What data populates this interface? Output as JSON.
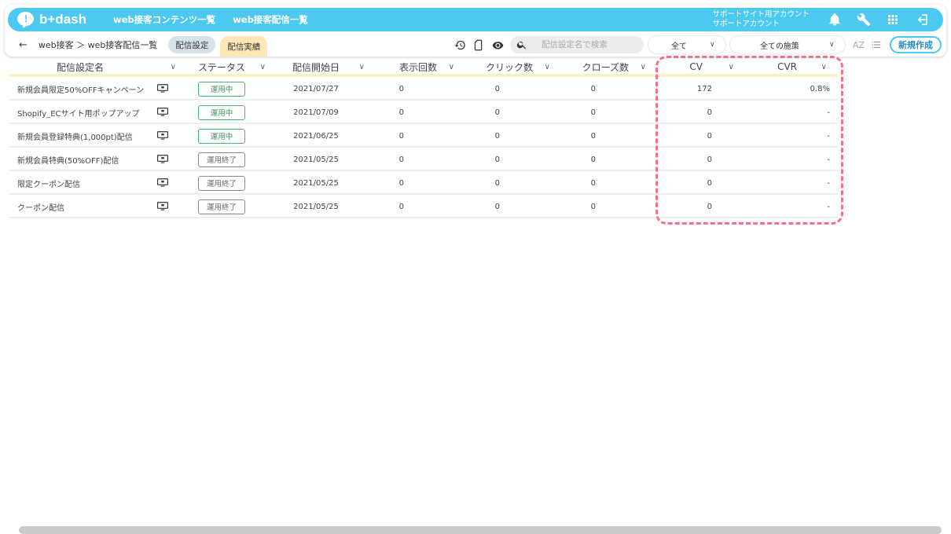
{
  "app": {
    "logo_text": "b+dash",
    "nav": [
      "web接客コンテンツ一覧",
      "web接客配信一覧"
    ],
    "account_line1": "サポートサイト用アカウント",
    "account_line2": "サポートアカウント",
    "accent_color": "#4cc9f0"
  },
  "subbar": {
    "back": "←",
    "breadcrumb": "web接客 ＞ web接客配信一覧",
    "tab_settings": "配信設定",
    "tab_results": "配信実績",
    "search_placeholder": "配信設定名で検索",
    "filter1": "全て",
    "filter2": "全ての施策",
    "sort_label": "AZ",
    "new_button": "新規作成"
  },
  "table": {
    "headers": {
      "name": "配信設定名",
      "status": "ステータス",
      "start": "配信開始日",
      "impressions": "表示回数",
      "clicks": "クリック数",
      "closes": "クローズ数",
      "cv": "CV",
      "cvr": "CVR"
    },
    "rows": [
      {
        "name": "新規会員限定50%OFFキャンペーン",
        "status": "運用中",
        "status_type": "active",
        "start": "2021/07/27",
        "impressions": "0",
        "clicks": "0",
        "closes": "0",
        "cv": "172",
        "cvr": "0.8%"
      },
      {
        "name": "Shopify_ECサイト用ポップアップ",
        "status": "運用中",
        "status_type": "active",
        "start": "2021/07/09",
        "impressions": "0",
        "clicks": "0",
        "closes": "0",
        "cv": "0",
        "cvr": "-"
      },
      {
        "name": "新規会員登録特典(1,000pt)配信",
        "status": "運用中",
        "status_type": "active",
        "start": "2021/06/25",
        "impressions": "0",
        "clicks": "0",
        "closes": "0",
        "cv": "0",
        "cvr": "-"
      },
      {
        "name": "新規会員特典(50%OFF)配信",
        "status": "運用終了",
        "status_type": "ended",
        "start": "2021/05/25",
        "impressions": "0",
        "clicks": "0",
        "closes": "0",
        "cv": "0",
        "cvr": "-"
      },
      {
        "name": "限定クーポン配信",
        "status": "運用終了",
        "status_type": "ended",
        "start": "2021/05/25",
        "impressions": "0",
        "clicks": "0",
        "closes": "0",
        "cv": "0",
        "cvr": "-"
      },
      {
        "name": "クーポン配信",
        "status": "運用終了",
        "status_type": "ended",
        "start": "2021/05/25",
        "impressions": "0",
        "clicks": "0",
        "closes": "0",
        "cv": "0",
        "cvr": "-"
      }
    ]
  },
  "colors": {
    "highlight": "#f07387",
    "active_status": "#48b46c",
    "ended_status": "#8a8a8a"
  }
}
